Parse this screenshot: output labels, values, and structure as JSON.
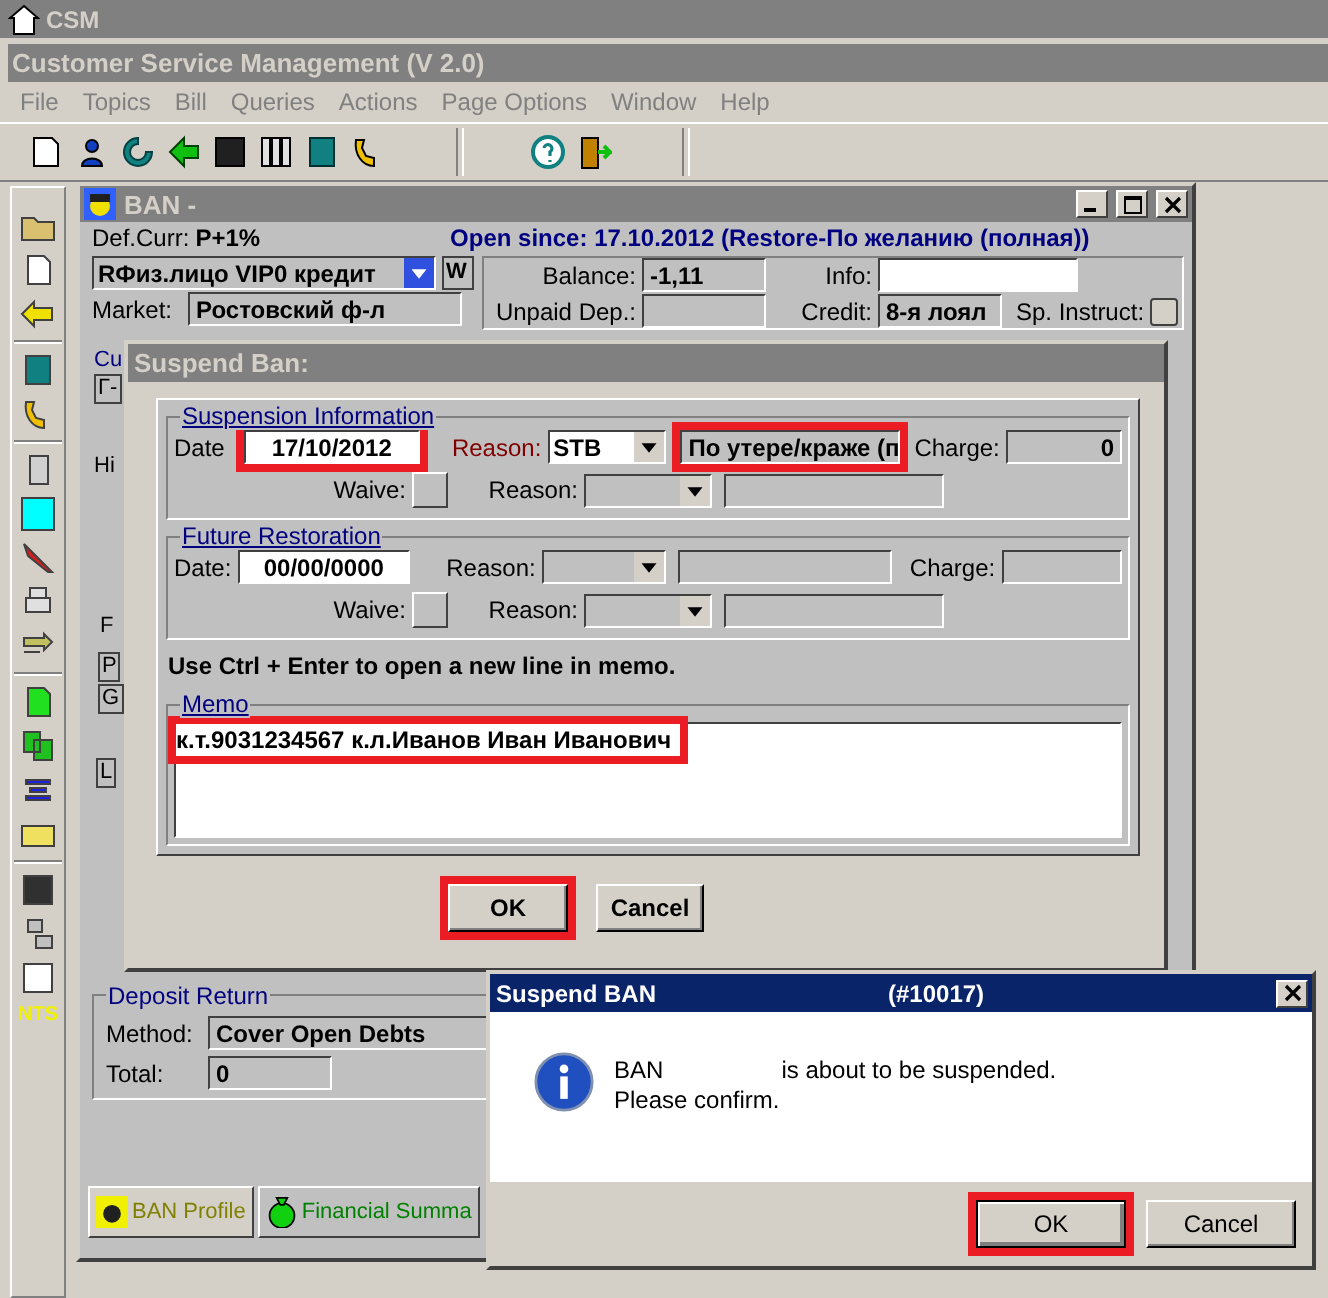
{
  "app": {
    "title": "CSM",
    "subtitle": "Customer Service Management  (V 2.0)"
  },
  "menu": [
    {
      "label": "File",
      "disabled": true
    },
    {
      "label": "Topics",
      "disabled": true
    },
    {
      "label": "Bill",
      "disabled": true
    },
    {
      "label": "Queries",
      "disabled": true
    },
    {
      "label": "Actions",
      "disabled": true
    },
    {
      "label": "Page Options",
      "disabled": true
    },
    {
      "label": "Window",
      "disabled": true
    },
    {
      "label": "Help",
      "disabled": true
    }
  ],
  "left_toolbar_logo": "NTS",
  "ban_window": {
    "title": "BAN -",
    "def_curr_label": "Def.Curr:",
    "def_curr": "P+1%",
    "open_since": "Open since: 17.10.2012 (Restore-По желанию (полная))",
    "account_type": "RФиз.лицо  VIP0  кредит",
    "w": "W",
    "market_label": "Market:",
    "market": "Ростовский ф-л",
    "balance_label": "Balance:",
    "balance": "-1,11",
    "unpaid_label": "Unpaid Dep.:",
    "info_label": "Info:",
    "credit_label": "Credit:",
    "credit": "8-я лоял",
    "sp_instruct_label": "Sp. Instruct:",
    "sp_instruct_checked": false,
    "fragments": [
      "Cu",
      "Г-",
      "Hi",
      "F",
      "P",
      "G",
      "L"
    ],
    "deposit": {
      "title": "Deposit Return",
      "method_label": "Method:",
      "method": "Cover Open Debts",
      "total_label": "Total:",
      "total": "0"
    },
    "tabs": [
      {
        "label": "BAN Profile",
        "selected": true
      },
      {
        "label": "Financial Summa",
        "selected": false
      }
    ]
  },
  "suspend_dialog": {
    "title": "Suspend Ban:",
    "suspension": {
      "title": "Suspension Information",
      "date_label": "Date",
      "date": {
        "value": "17/10/2012",
        "highlighted": true
      },
      "reason_label": "Reason:",
      "reason": "STB",
      "reason_desc": {
        "value": "По утере/краже (п",
        "highlighted": true
      },
      "charge_label": "Charge:",
      "charge": "0",
      "waive_label": "Waive:",
      "reason2_label": "Reason:"
    },
    "restoration": {
      "title": "Future Restoration",
      "date_label": "Date:",
      "date": "00/00/0000",
      "reason_label": "Reason:",
      "charge_label": "Charge:",
      "waive_label": "Waive:",
      "reason2_label": "Reason:"
    },
    "hint": "Use Ctrl + Enter to open a new line in memo.",
    "memo_label": "Memo",
    "memo": {
      "value": "к.т.9031234567 к.л.Иванов Иван Иванович",
      "highlighted": true
    },
    "buttons": [
      {
        "label": "OK",
        "highlighted": true
      },
      {
        "label": "Cancel",
        "highlighted": false
      }
    ]
  },
  "confirm": {
    "title": "Suspend BAN",
    "code": "(#10017)",
    "line_1a": "BAN",
    "line_1b": "is about to be suspended.",
    "line_2": "Please confirm.",
    "buttons": [
      {
        "label": "OK",
        "highlighted": true
      },
      {
        "label": "Cancel",
        "highlighted": false
      }
    ]
  }
}
